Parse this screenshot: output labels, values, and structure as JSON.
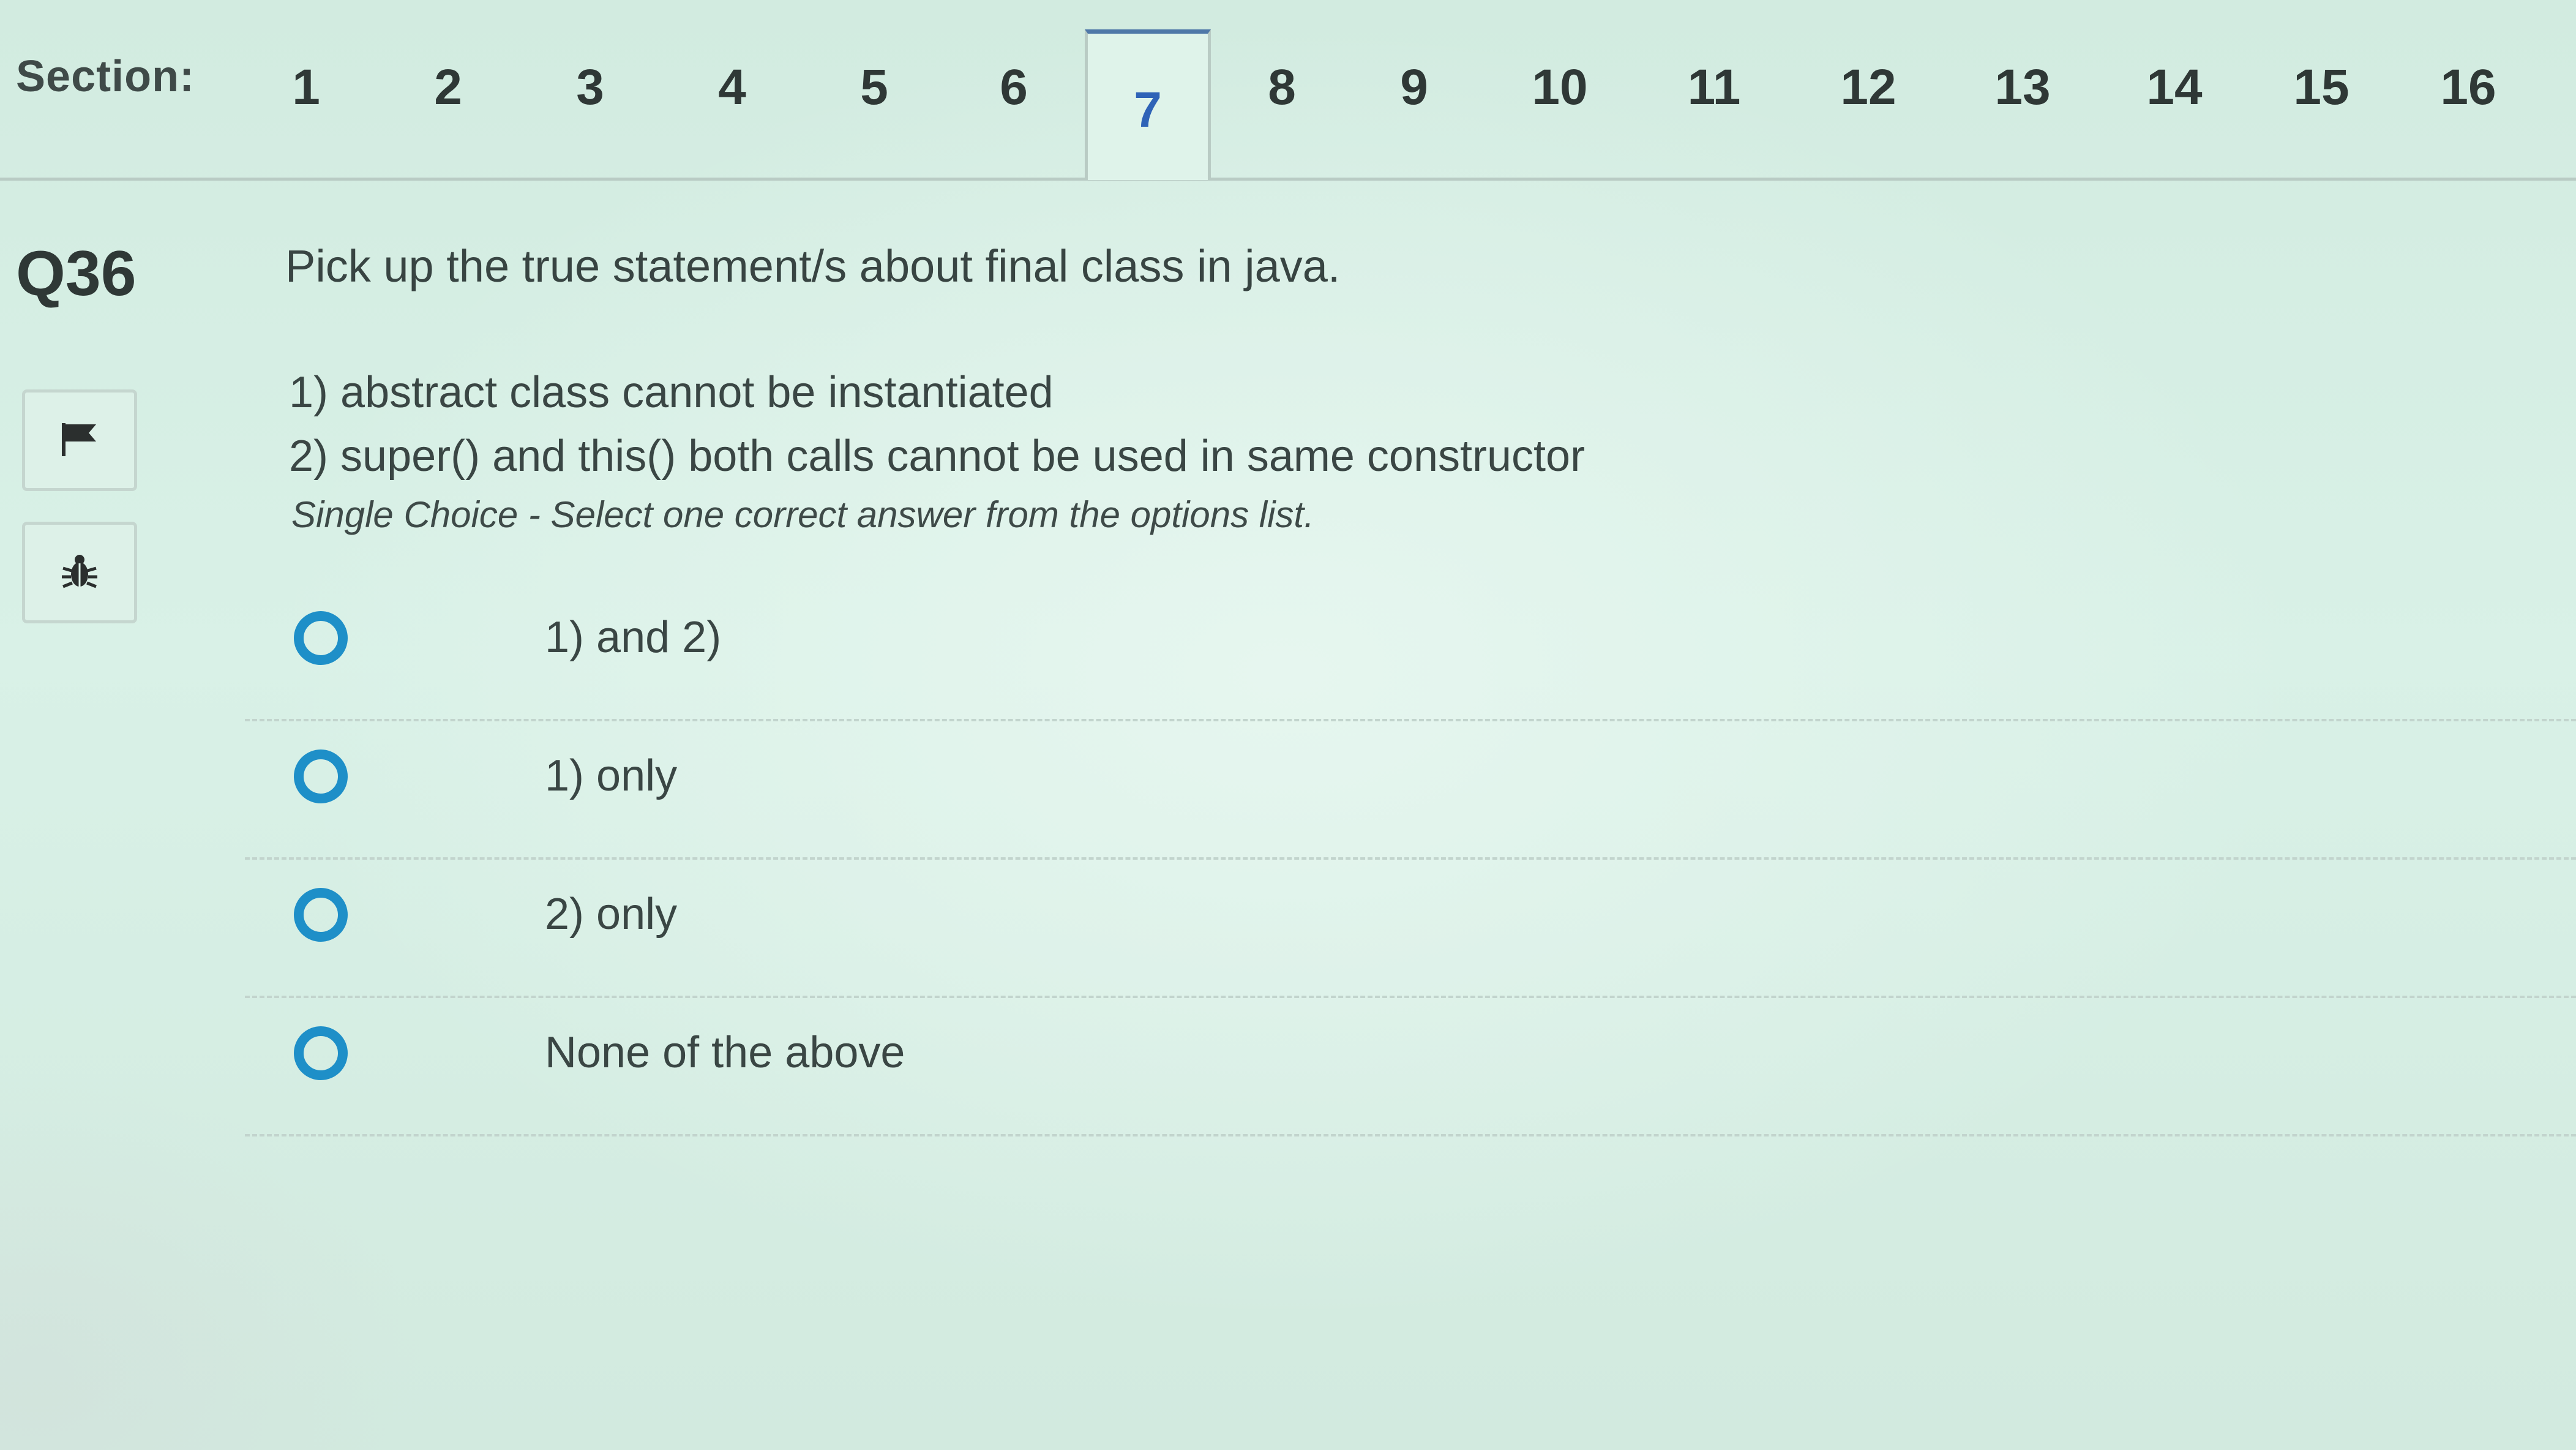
{
  "section": {
    "label": "Section:",
    "tabs": [
      "1",
      "2",
      "3",
      "4",
      "5",
      "6",
      "7",
      "8",
      "9",
      "10",
      "11",
      "12",
      "13",
      "14",
      "15",
      "16"
    ],
    "active_tab": "7"
  },
  "question": {
    "number": "Q36",
    "text": "Pick up the true statement/s about final class in java.",
    "statements": [
      "1) abstract class cannot be instantiated",
      "2) super() and this() both calls cannot be used in same constructor"
    ],
    "hint": "Single Choice - Select one correct answer from the options list."
  },
  "side_buttons": {
    "flag_icon": "flag-icon",
    "bug_icon": "bug-icon"
  },
  "options": [
    {
      "label": "1) and 2)"
    },
    {
      "label": "1) only"
    },
    {
      "label": "2) only"
    },
    {
      "label": "None of the above"
    }
  ],
  "colors": {
    "accent": "#2f63b7",
    "radio": "#1e8fc8",
    "background": "#d9f1e7"
  }
}
